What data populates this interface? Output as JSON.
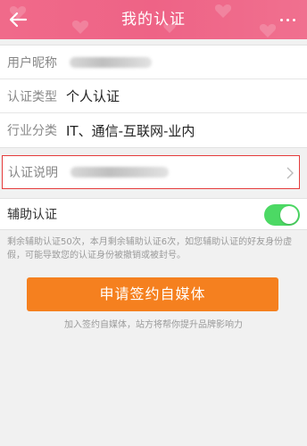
{
  "header": {
    "title": "我的认证",
    "back_icon": "back-arrow-icon",
    "more_icon": "more-dots-icon",
    "color": "#ee6386"
  },
  "profile": {
    "nickname_label": "用户昵称",
    "type_label": "认证类型",
    "type_value": "个人认证",
    "industry_label": "行业分类",
    "industry_value": "IT、通信-互联网-业内"
  },
  "auth_desc": {
    "label": "认证说明",
    "chevron_icon": "chevron-right-icon"
  },
  "assist": {
    "label": "辅助认证",
    "enabled": true,
    "toggle_color": "#4cd964"
  },
  "note": "剩余辅助认证50次，本月剩余辅助认证6次，如您辅助认证的好友身份虚假，可能导致您的认证身份被撤销或被封号。",
  "apply_button": {
    "label": "申请签约自媒体",
    "color": "#f5801f"
  },
  "hint": "加入签约自媒体，站方将帮你提升品牌影响力"
}
